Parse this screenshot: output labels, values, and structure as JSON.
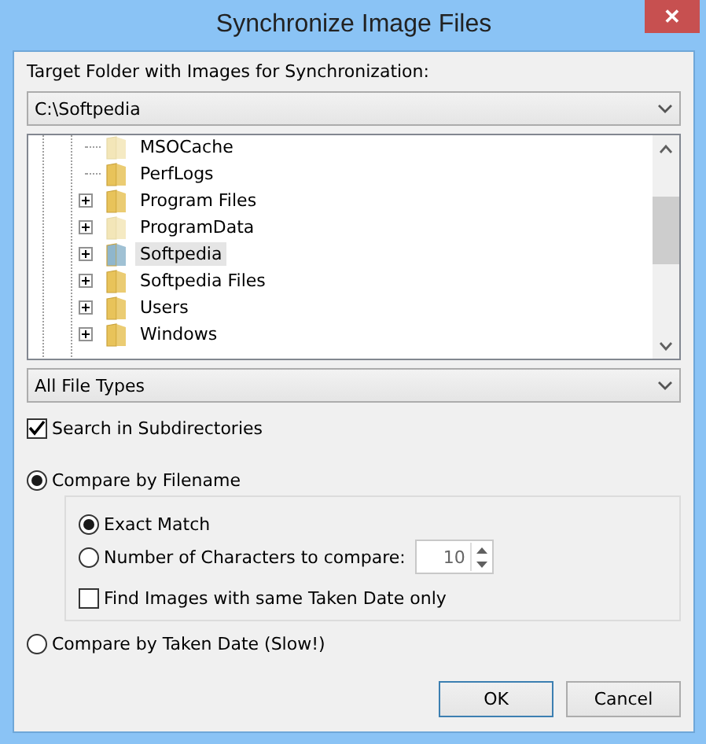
{
  "window": {
    "title": "Synchronize Image Files",
    "close": "✕"
  },
  "target": {
    "label": "Target Folder with Images for Synchronization:",
    "value": "C:\\Softpedia"
  },
  "tree": {
    "items": [
      {
        "label": "MSOCache",
        "expandable": false,
        "hidden": true,
        "selected": false
      },
      {
        "label": "PerfLogs",
        "expandable": false,
        "hidden": false,
        "selected": false
      },
      {
        "label": "Program Files",
        "expandable": true,
        "hidden": false,
        "selected": false
      },
      {
        "label": "ProgramData",
        "expandable": true,
        "hidden": true,
        "selected": false
      },
      {
        "label": "Softpedia",
        "expandable": true,
        "hidden": false,
        "selected": true
      },
      {
        "label": "Softpedia Files",
        "expandable": true,
        "hidden": false,
        "selected": false
      },
      {
        "label": "Users",
        "expandable": true,
        "hidden": false,
        "selected": false
      },
      {
        "label": "Windows",
        "expandable": true,
        "hidden": false,
        "selected": false
      }
    ]
  },
  "file_types": {
    "value": "All File Types"
  },
  "search_subdirectories": {
    "label": "Search in Subdirectories",
    "checked": true
  },
  "compare_by_filename": {
    "label": "Compare by Filename",
    "selected": true
  },
  "filename_options": {
    "exact_match": {
      "label": "Exact Match",
      "selected": true
    },
    "number_of_characters": {
      "label": "Number of Characters to compare:",
      "selected": false,
      "value": "10"
    },
    "same_taken_date": {
      "label": "Find Images with same Taken Date only",
      "checked": false
    }
  },
  "compare_by_taken_date": {
    "label": "Compare by Taken Date (Slow!)",
    "selected": false
  },
  "buttons": [
    {
      "label": "OK",
      "default": true
    },
    {
      "label": "Cancel",
      "default": false
    }
  ]
}
